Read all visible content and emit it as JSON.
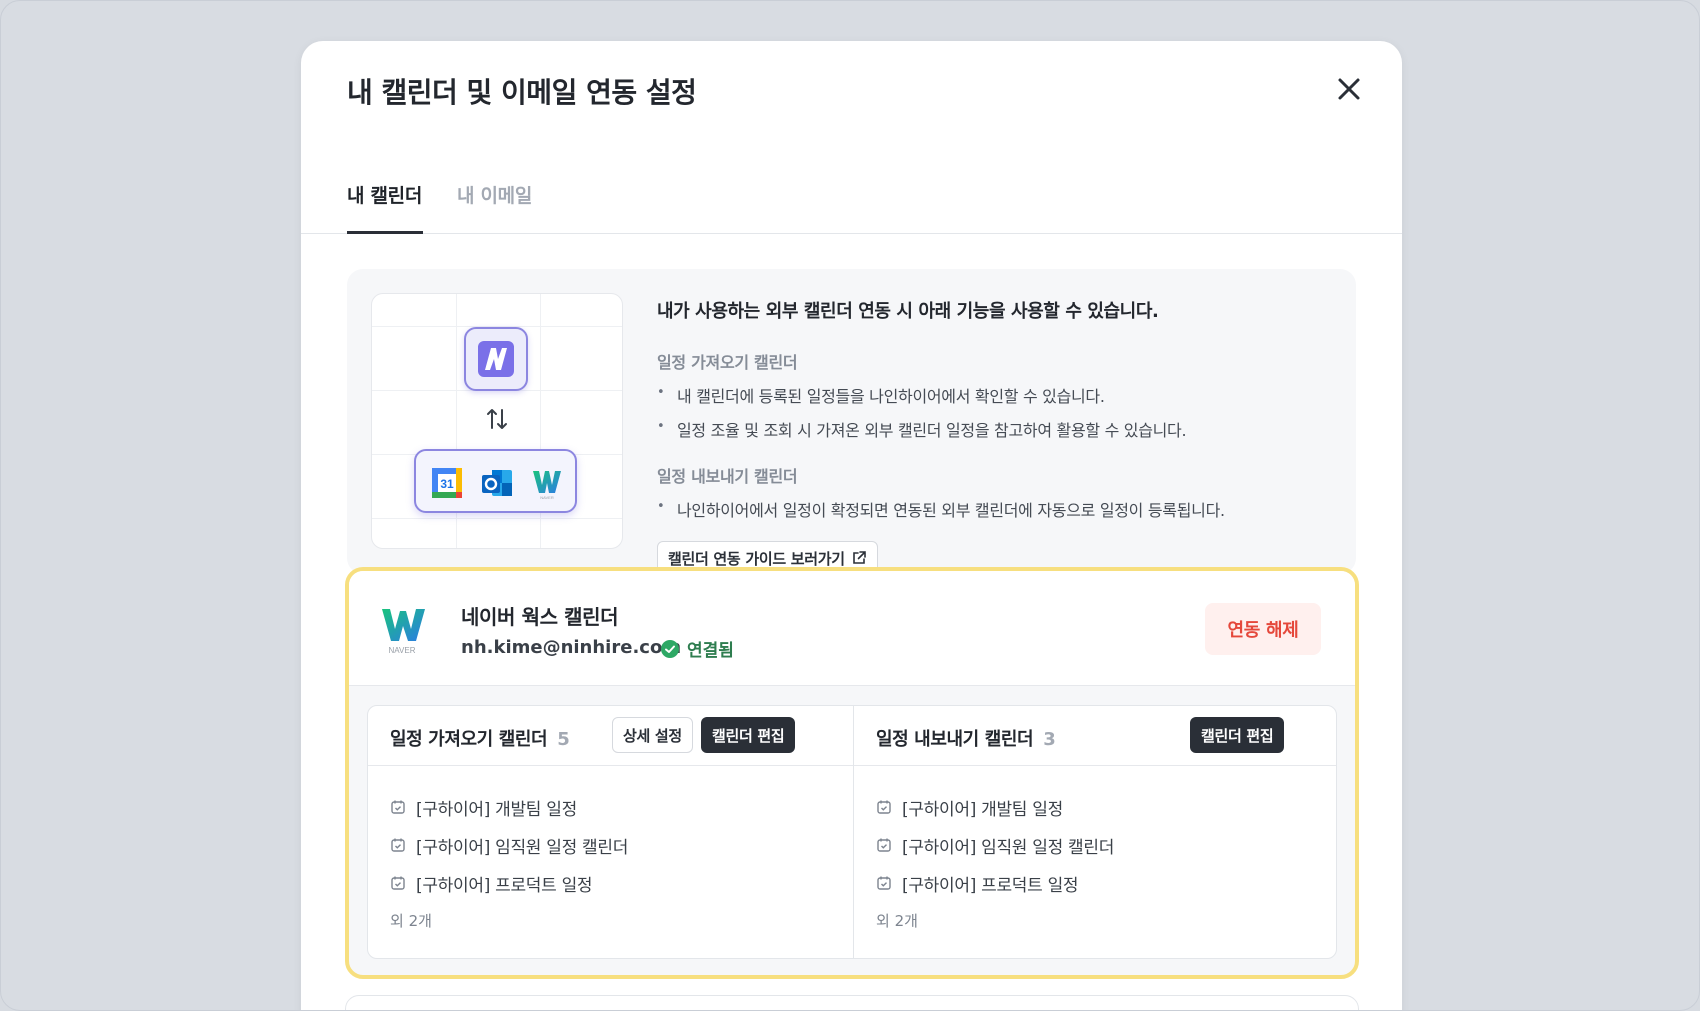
{
  "modal": {
    "title": "내 캘린더 및 이메일 연동 설정",
    "close_icon": "close-icon"
  },
  "tabs": [
    {
      "label": "내 캘린더",
      "active": true
    },
    {
      "label": "내 이메일",
      "active": false
    }
  ],
  "info": {
    "headline": "내가 사용하는 외부 캘린더 연동 시 아래 기능을 사용할 수 있습니다.",
    "import_title": "일정 가져오기 캘린더",
    "import_bullets": [
      "내 캘린더에 등록된 일정들을 나인하이어에서 확인할 수 있습니다.",
      "일정 조율 및 조회 시 가져온 외부 캘린더 일정을 참고하여 활용할 수 있습니다."
    ],
    "export_title": "일정 내보내기 캘린더",
    "export_bullets": [
      "나인하이어에서 일정이 확정되면 연동된 외부 캘린더에 자동으로 일정이 등록됩니다."
    ],
    "guide_button": "캘린더 연동 가이드 보러가기",
    "apps": [
      "google-calendar-icon",
      "outlook-icon",
      "naver-works-icon"
    ],
    "google_day": "31",
    "naver_mark": "NAVER"
  },
  "connection": {
    "provider": "네이버 웍스 캘린더",
    "email": "nh.kime@ninhire.com",
    "status": "연결됨",
    "unlink_button": "연동 해제",
    "naver_mark": "NAVER",
    "import_panel": {
      "title": "일정 가져오기 캘린더",
      "count": "5",
      "detail_button": "상세 설정",
      "edit_button": "캘린더 편집",
      "items": [
        "[구하이어] 개발팀 일정",
        "[구하이어] 임직원 일정 캘린더",
        "[구하이어] 프로덕트 일정"
      ],
      "more": "외 2개"
    },
    "export_panel": {
      "title": "일정 내보내기 캘린더",
      "count": "3",
      "edit_button": "캘린더 편집",
      "items": [
        "[구하이어] 개발팀 일정",
        "[구하이어] 임직원 일정 캘린더",
        "[구하이어] 프로덕트 일정"
      ],
      "more": "외 2개"
    }
  },
  "colors": {
    "accent_purple": "#8c86e0",
    "highlight_yellow": "#f7df7f",
    "status_green": "#2e7d4f",
    "danger_red": "#e5483b"
  }
}
